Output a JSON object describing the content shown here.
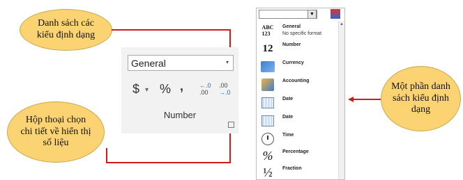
{
  "callouts": {
    "top_left": "Danh sách các\nkiểu định dạng",
    "bottom_left": "Hộp thoại chọn\nchi tiết về hiển thị\nsố liệu",
    "right": "Một phần danh\nsách kiểu định\ndạng"
  },
  "ribbon": {
    "format_value": "General",
    "currency_symbol": "$",
    "dropdown_caret": "▾",
    "percent_symbol": "%",
    "comma_symbol": ",",
    "increase_decimal_top": "←.0",
    "increase_decimal_bottom": ".00",
    "decrease_decimal_top": ".00",
    "decrease_decimal_bottom": "→.0",
    "group_label": "Number"
  },
  "gallery": {
    "items": [
      {
        "label": "General",
        "sublabel": "No specific format",
        "icon": "ABC\n123"
      },
      {
        "label": "Number",
        "icon": "12"
      },
      {
        "label": "Currency",
        "icon": ""
      },
      {
        "label": "Accounting",
        "icon": ""
      },
      {
        "label": "Date",
        "icon": ""
      },
      {
        "label": "Date",
        "icon": ""
      },
      {
        "label": "Time",
        "icon": ""
      },
      {
        "label": "Percentage",
        "icon": "%"
      },
      {
        "label": "Fraction",
        "icon": "½"
      }
    ]
  },
  "colors": {
    "bubble": "#fbd372",
    "connector": "#d11a1a"
  }
}
